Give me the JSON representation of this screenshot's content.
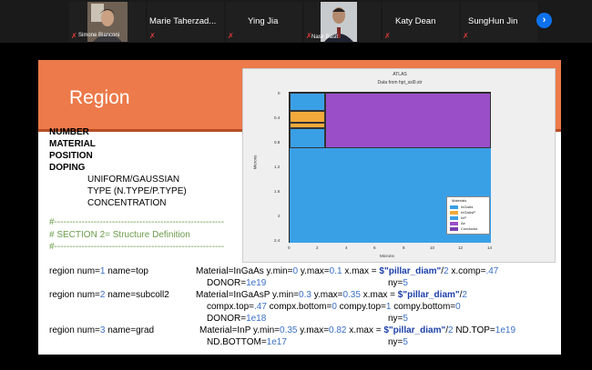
{
  "participants": [
    {
      "name": "Simone Bianconi",
      "video": true
    },
    {
      "name": "Marie  Taherzad...",
      "video": false
    },
    {
      "name": "Ying Jia",
      "video": false
    },
    {
      "name": "Nasir Basit",
      "video": true
    },
    {
      "name": "Katy Dean",
      "video": false
    },
    {
      "name": "SungHun Jin",
      "video": false
    }
  ],
  "next_icon": "chevron-right-icon",
  "slide": {
    "title": "Region",
    "keywords": [
      "NUMBER",
      "MATERIAL",
      "POSITION",
      "DOPING"
    ],
    "options": [
      "UNIFORM/GAUSSIAN",
      "TYPE (N.TYPE/P.TYPE)",
      "CONCENTRATION"
    ],
    "comment_rule_1": "#--------------------------------------------------------",
    "comment_section": "# SECTION 2= Structure Definition",
    "comment_rule_2": "#--------------------------------------------------------",
    "code": {
      "l1a": "region num=",
      "l1a_n": "1",
      "l1b": " name=top",
      "l1c": "Material=InGaAs  y.min=",
      "l1c_n": "0",
      "l1d": "   y.max=",
      "l1d_n": "0.1",
      "l1e": "  x.max = ",
      "l1e_s": "$\"pillar_diam\"",
      "l1f": "/",
      "l1f_n": "2",
      "l1g": " x.comp=",
      "l1g_n": ".47",
      "l2a": "DONOR=",
      "l2a_n": "1e19",
      "l2b": "ny=",
      "l2b_n": "5",
      "l3a": "region num=",
      "l3a_n": "2",
      "l3b": " name=subcoll2",
      "l3c": "Material=InGaAsP y.min=",
      "l3c_n": "0.3",
      "l3d": "  y.max=",
      "l3d_n": "0.35",
      "l3e": " x.max = ",
      "l3e_s": "$\"pillar_diam\"",
      "l3f": "/",
      "l3f_n": "2",
      "l4a": "compx.top=",
      "l4a_n": ".47",
      "l4b": " compx.bottom=",
      "l4b_n": "0",
      "l4c": " compy.top=",
      "l4c_n": "1",
      "l4d": " compy.bottom=",
      "l4d_n": "0",
      "l5a": "DONOR=",
      "l5a_n": "1e18",
      "l5b": "ny=",
      "l5b_n": "5",
      "l6a": "region num=",
      "l6a_n": "3",
      "l6b": " name=grad",
      "l6c": "Material=InP  y.min=",
      "l6c_n": "0.35",
      "l6d": "   y.max=",
      "l6d_n": "0.82",
      "l6e": " x.max = ",
      "l6e_s": "$\"pillar_diam\"",
      "l6f": "/",
      "l6f_n": "2",
      "l6g": " ND.TOP=",
      "l6g_n": "1e19",
      "l7a": "ND.BOTTOM=",
      "l7a_n": "1e17",
      "l7b": "ny=",
      "l7b_n": "5"
    }
  },
  "plot": {
    "title": "ATLAS",
    "subtitle": "Data from hpt_ssl0.str",
    "ylabel": "Microns",
    "xlabel": "Microns",
    "yticks": [
      "0",
      "0.4",
      "0.8",
      "1.2",
      "1.6",
      "2",
      "2.4"
    ],
    "xticks": [
      "0",
      "2",
      "4",
      "6",
      "8",
      "10",
      "12",
      "14"
    ],
    "legend_title": "Materials",
    "legend": [
      {
        "label": "InGaAs",
        "color": "#3aa0e6"
      },
      {
        "label": "InGaAsP",
        "color": "#f2a93b"
      },
      {
        "label": "InP",
        "color": "#3aa0e6"
      },
      {
        "label": "Air",
        "color": "#9a4fc9"
      },
      {
        "label": "Conductor",
        "color": "#7a3fb0"
      }
    ]
  }
}
